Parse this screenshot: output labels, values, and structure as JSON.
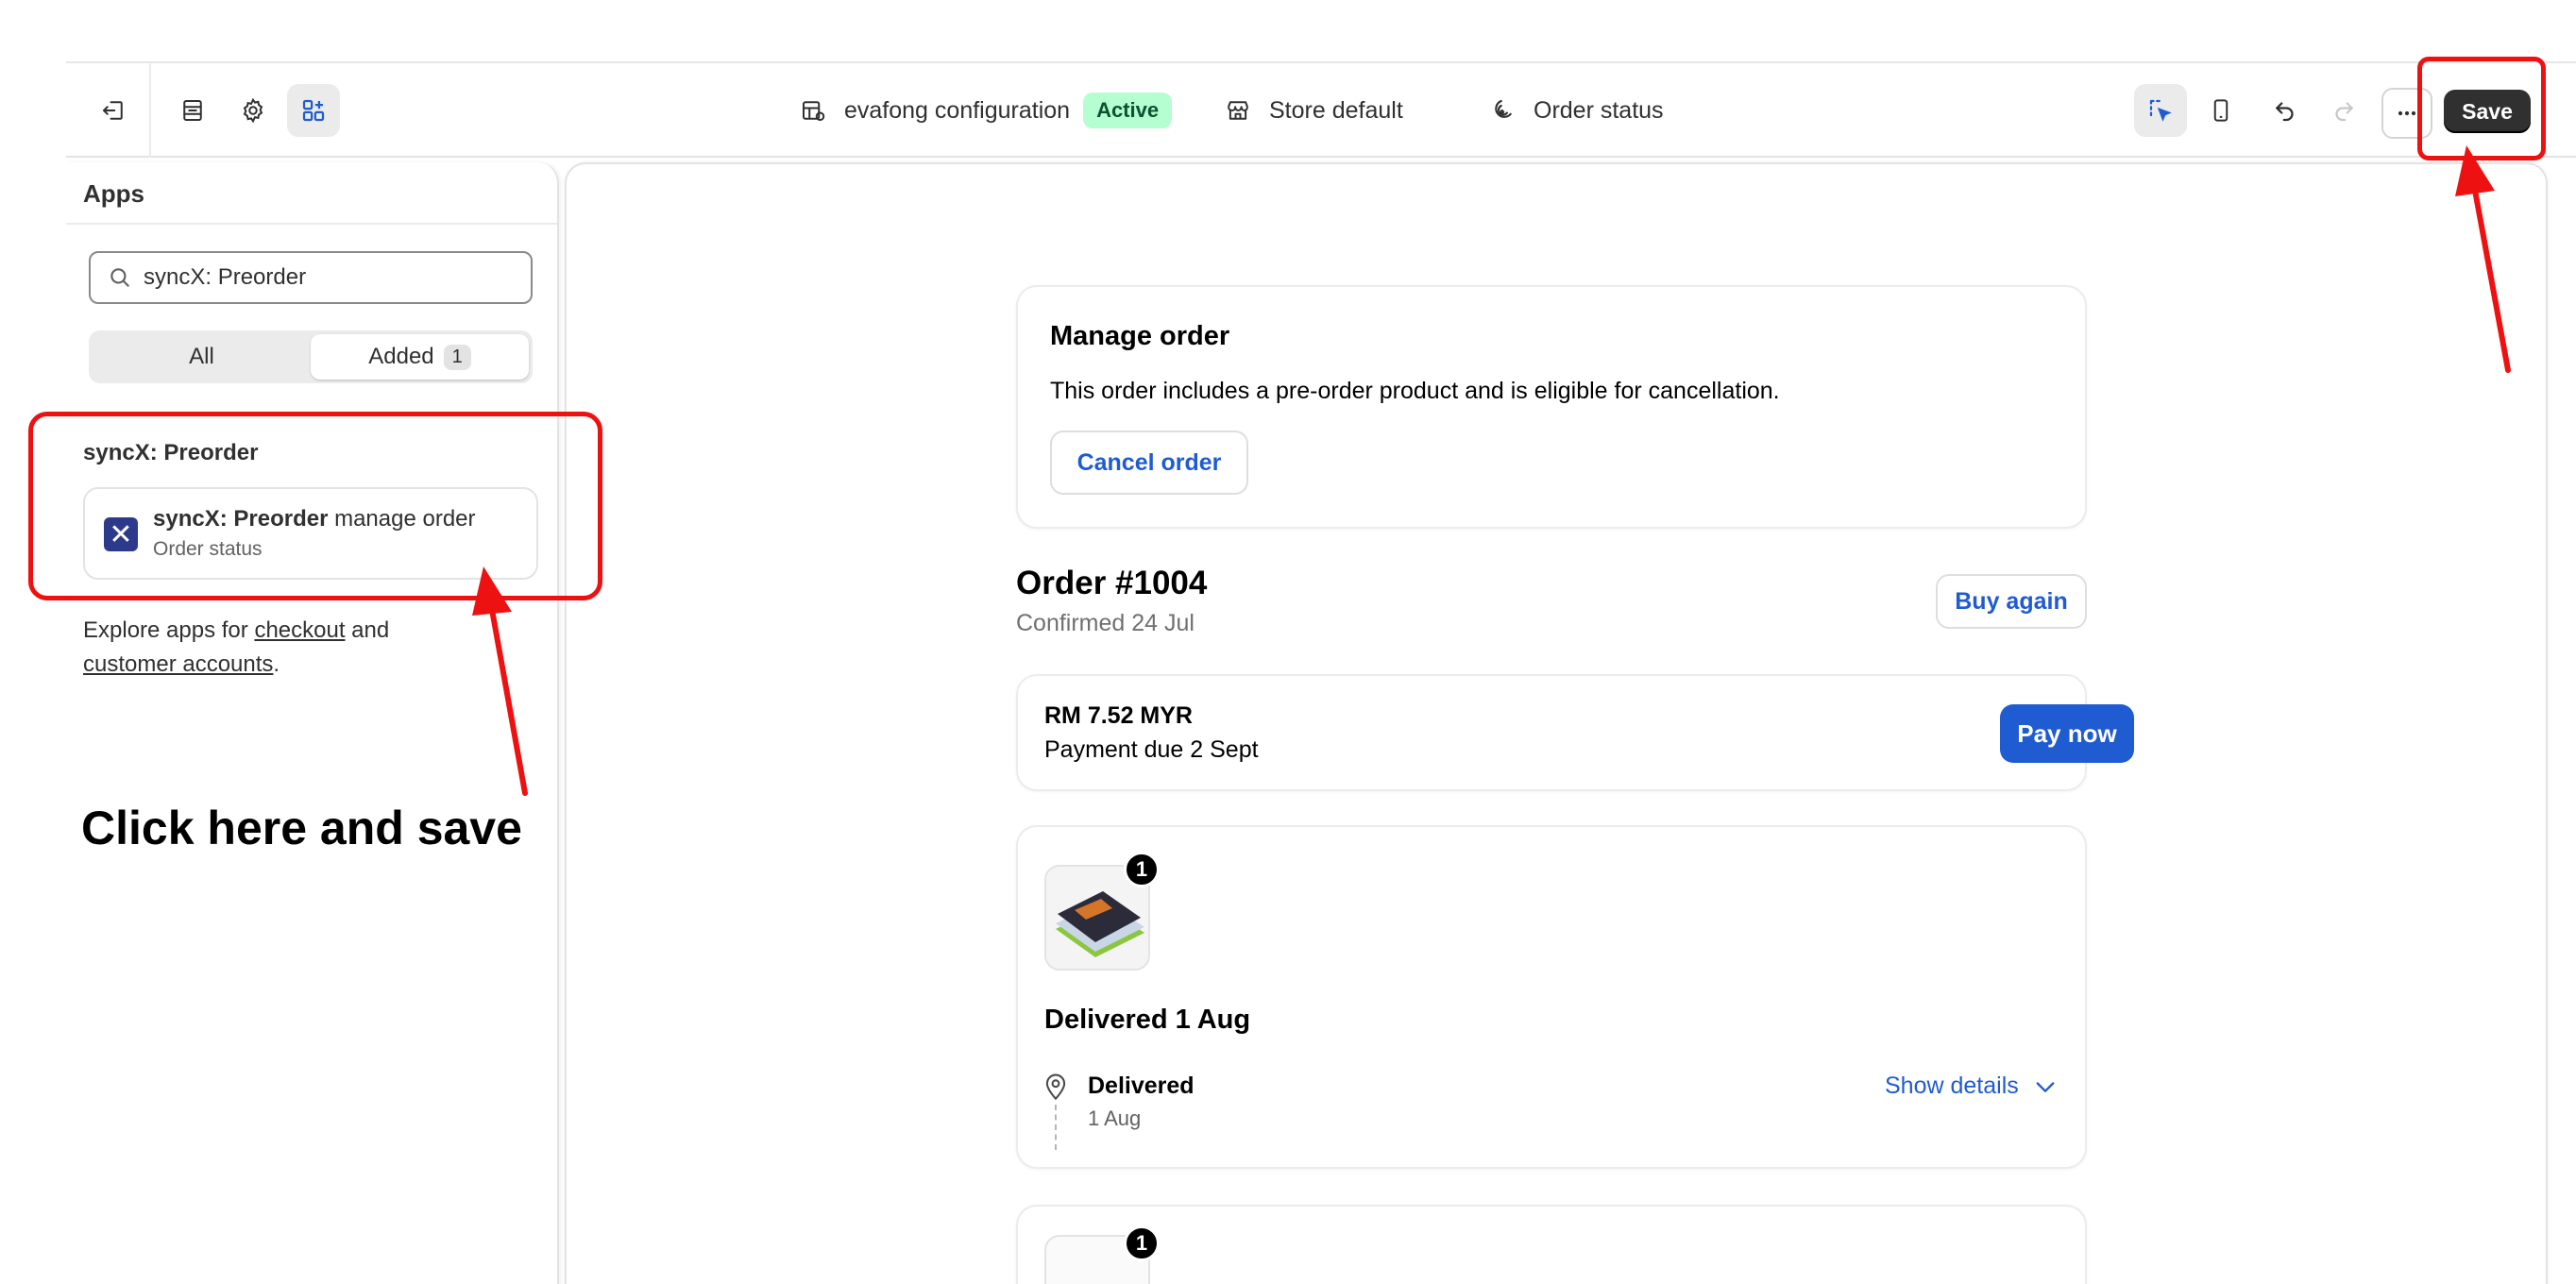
{
  "topbar": {
    "config_name": "evafong configuration",
    "status_badge": "Active",
    "store": "Store default",
    "page": "Order status",
    "save_label": "Save"
  },
  "sidebar": {
    "title": "Apps",
    "search_value": "syncX: Preorder",
    "filter_all": "All",
    "filter_added": "Added",
    "added_count": "1",
    "group_title": "syncX: Preorder",
    "app": {
      "name_bold": "syncX: Preorder",
      "name_rest": " manage order",
      "subtitle": "Order status"
    },
    "explore": {
      "prefix": "Explore apps for ",
      "link1": "checkout",
      "middle": " and ",
      "link2": "customer accounts",
      "suffix": "."
    }
  },
  "annotation": {
    "instruction": "Click here and save",
    "color": "#ee1111"
  },
  "preview": {
    "manage_order": {
      "title": "Manage order",
      "text": "This order includes a pre-order product and is eligible for cancellation.",
      "cancel_label": "Cancel order"
    },
    "order": {
      "title": "Order #1004",
      "confirmed": "Confirmed 24 Jul",
      "buy_again": "Buy again"
    },
    "payment": {
      "amount": "RM 7.52 MYR",
      "due": "Payment due 2 Sept",
      "pay_now": "Pay now"
    },
    "fulfillment": {
      "quantity": "1",
      "title": "Delivered 1 Aug",
      "status": "Delivered",
      "date": "1 Aug",
      "show_details": "Show details"
    },
    "next_quantity": "1"
  },
  "colors": {
    "accent_blue": "#1f5bd1",
    "active_badge_bg": "#b4fed2",
    "save_bg": "#303030"
  }
}
